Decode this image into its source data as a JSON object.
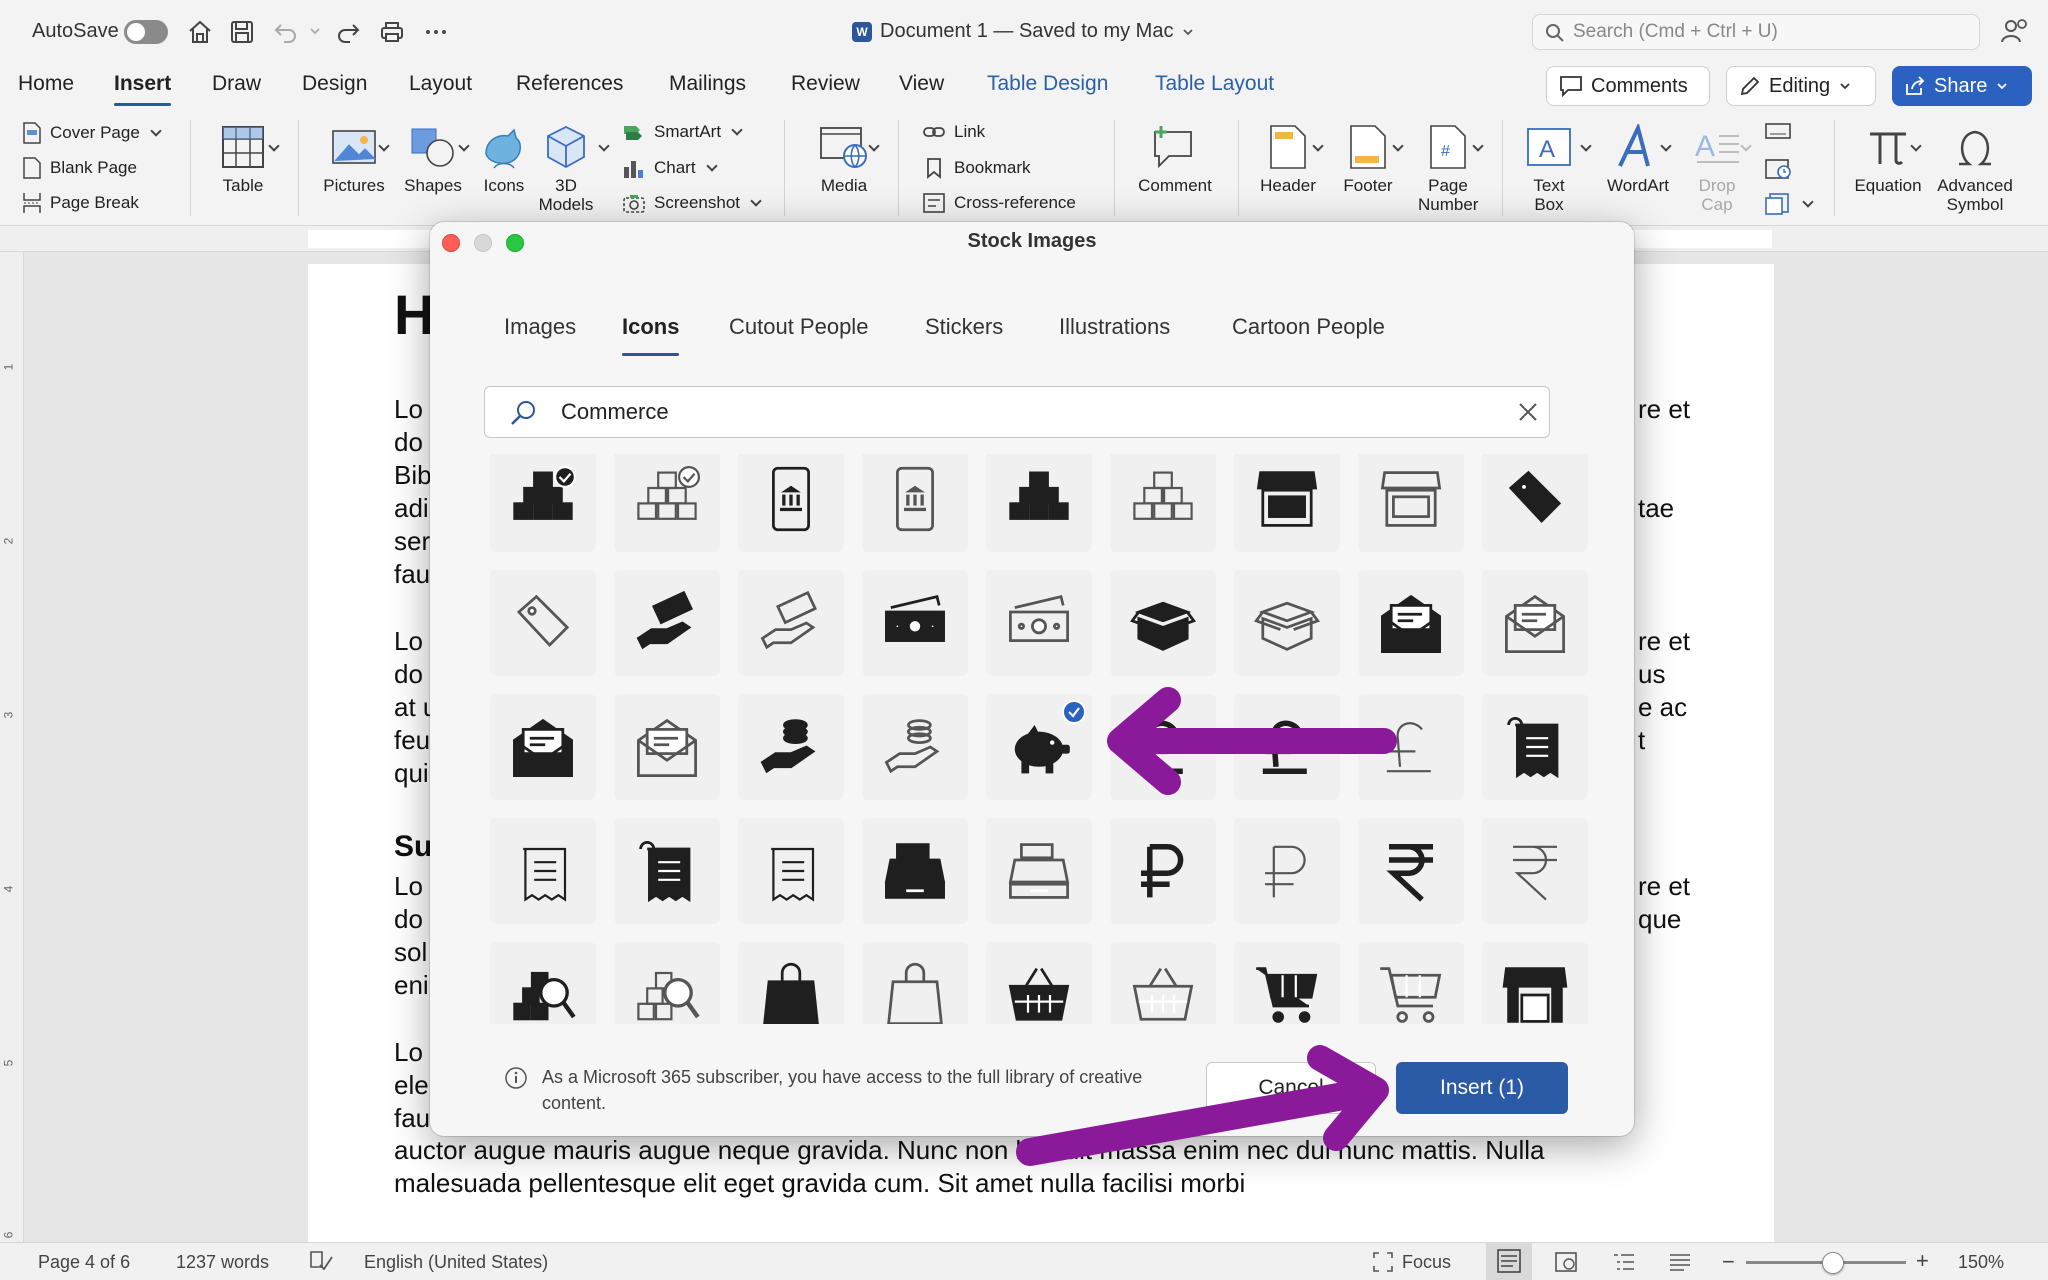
{
  "titlebar": {
    "autosave_label": "AutoSave",
    "document_title": "Document 1 — Saved to my Mac",
    "search_placeholder": "Search (Cmd + Ctrl + U)"
  },
  "menu": {
    "tabs": [
      "Home",
      "Insert",
      "Draw",
      "Design",
      "Layout",
      "References",
      "Mailings",
      "Review",
      "View",
      "Table Design",
      "Table Layout"
    ],
    "active_tab": "Insert",
    "comments_label": "Comments",
    "editing_label": "Editing",
    "share_label": "Share"
  },
  "ribbon": {
    "pages": [
      "Cover Page",
      "Blank Page",
      "Page Break"
    ],
    "table": "Table",
    "pictures": "Pictures",
    "shapes": "Shapes",
    "icons": "Icons",
    "models_3d": "3D Models",
    "smartart": "SmartArt",
    "chart": "Chart",
    "screenshot": "Screenshot",
    "media": "Media",
    "link": "Link",
    "bookmark": "Bookmark",
    "cross_reference": "Cross-reference",
    "comment": "Comment",
    "header": "Header",
    "footer": "Footer",
    "page_number": "Page Number",
    "text_box": "Text Box",
    "wordart": "WordArt",
    "drop_cap": "Drop Cap",
    "equation": "Equation",
    "advanced_symbol": "Advanced Symbol"
  },
  "document": {
    "heading": "H",
    "subheading": "Su",
    "left_fragments": [
      "Lo",
      "do",
      "Bib",
      "adi",
      "ser",
      "fau",
      "Lo",
      "do",
      "at u",
      "feu",
      "qui",
      "Lo",
      "do",
      "sol",
      "eni",
      "Lo",
      "ele",
      "fau"
    ],
    "right_fragments": [
      "re et",
      "tae",
      "re et",
      "us",
      "e ac",
      "t",
      "re et",
      "que"
    ],
    "line_1": "auctor augue mauris augue neque gravida. Nunc non blandit massa enim nec dui nunc mattis. Nulla",
    "line_2": "malesuada pellentesque elit eget gravida cum. Sit amet nulla facilisi morbi"
  },
  "status": {
    "page": "Page 4 of 6",
    "words": "1237 words",
    "language": "English (United States)",
    "focus": "Focus",
    "zoom": "150%"
  },
  "dialog": {
    "title": "Stock Images",
    "tabs": [
      "Images",
      "Icons",
      "Cutout People",
      "Stickers",
      "Illustrations",
      "Cartoon People"
    ],
    "active_tab": "Icons",
    "search_value": "Commerce",
    "icons": [
      "boxes-check-solid-icon",
      "boxes-check-outline-icon",
      "mobile-bank-solid-icon",
      "mobile-bank-outline-icon",
      "boxes-stack-solid-icon",
      "boxes-stack-outline-icon",
      "storefront-solid-icon",
      "storefront-outline-icon",
      "price-tag-solid-icon",
      "price-tag-outline-icon",
      "hand-money-solid-icon",
      "hand-money-outline-icon",
      "banknote-solid-icon",
      "banknote-outline-icon",
      "open-box-solid-icon",
      "open-box-outline-icon",
      "envelope-cheque-solid-icon",
      "envelope-cheque-outline-icon",
      "envelope-letter-solid-icon",
      "envelope-letter-outline-icon",
      "hand-coins-solid-icon",
      "hand-coins-outline-icon",
      "piggy-bank-solid-icon",
      "pound-solid-icon",
      "pound-regular-icon",
      "pound-outline-icon",
      "receipt-solid-icon",
      "receipt-outline-icon",
      "receipt-bold-icon",
      "receipt-thin-icon",
      "cash-register-solid-icon",
      "cash-register-outline-icon",
      "ruble-bold-icon",
      "ruble-thin-icon",
      "rupee-bold-icon",
      "rupee-thin-icon",
      "inventory-search-solid-icon",
      "inventory-search-outline-icon",
      "shopping-bag-solid-icon",
      "shopping-bag-outline-icon",
      "shopping-basket-solid-icon",
      "shopping-basket-outline-icon",
      "shopping-cart-solid-icon",
      "shopping-cart-outline-icon",
      "market-stall-solid-icon"
    ],
    "selected_index": 22,
    "info_text": "As a Microsoft 365 subscriber, you have access to the full library of creative content.",
    "cancel_label": "Cancel",
    "insert_label": "Insert (1)"
  },
  "colors": {
    "accent": "#2b579a",
    "annotation_arrow": "#8b1a9b",
    "insert_button": "#2b5aa6"
  }
}
